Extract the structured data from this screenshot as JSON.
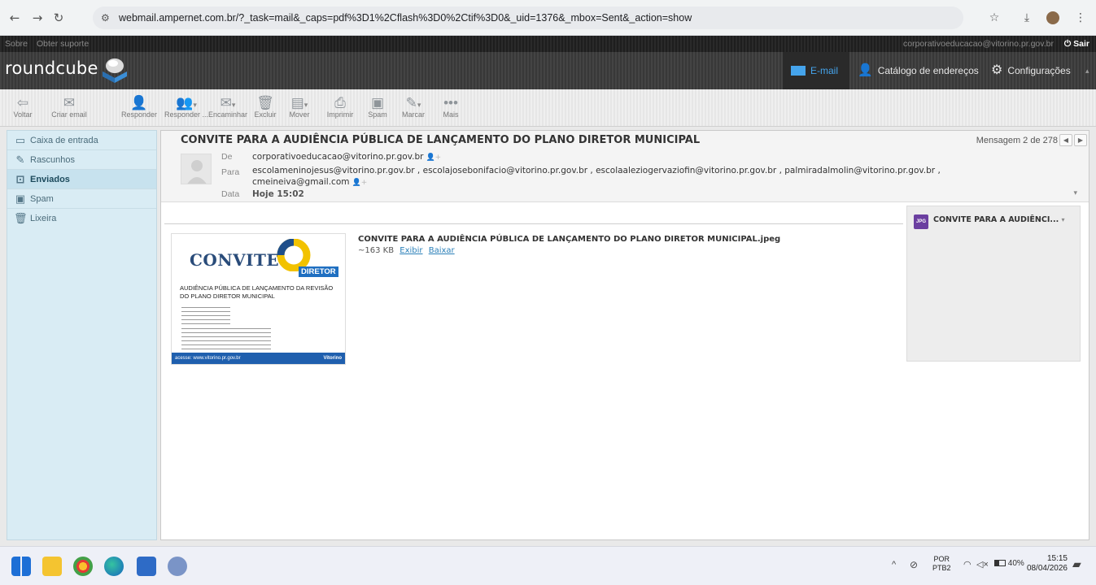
{
  "browser": {
    "url": "webmail.ampernet.com.br/?_task=mail&_caps=pdf%3D1%2Cflash%3D0%2Ctif%3D0&_uid=1376&_mbox=Sent&_action=show"
  },
  "topline": {
    "links": [
      "Sobre",
      "Obter suporte"
    ],
    "user_email": "corporativoeducacao@vitorino.pr.gov.br",
    "logout_label": "Sair"
  },
  "header": {
    "logo_text": "roundcube",
    "nav": {
      "email": "E-mail",
      "contacts": "Catálogo de endereços",
      "settings": "Configurações"
    }
  },
  "toolbar": {
    "back": "Voltar",
    "compose": "Criar email",
    "reply": "Responder",
    "reply_all": "Responder ...",
    "forward": "Encaminhar",
    "delete": "Excluir",
    "move": "Mover",
    "print": "Imprimir",
    "spam": "Spam",
    "mark": "Marcar",
    "more": "Mais"
  },
  "sidebar": {
    "folders": [
      {
        "label": "Caixa de entrada",
        "icon": "inbox-icon"
      },
      {
        "label": "Rascunhos",
        "icon": "pencil-icon"
      },
      {
        "label": "Enviados",
        "icon": "sent-icon",
        "selected": true
      },
      {
        "label": "Spam",
        "icon": "spam-icon"
      },
      {
        "label": "Lixeira",
        "icon": "trash-icon"
      }
    ]
  },
  "message": {
    "subject": "CONVITE PARA A AUDIÊNCIA PÚBLICA DE LANÇAMENTO DO PLANO DIRETOR MUNICIPAL",
    "counter": "Mensagem 2 de 278",
    "from_label": "De",
    "from": "corporativoeducacao@vitorino.pr.gov.br",
    "to_label": "Para",
    "to_line1": "escolameninojesus@vitorino.pr.gov.br , escolajosebonifacio@vitorino.pr.gov.br , escolaaleziogervaziofin@vitorino.pr.gov.br , palmiradalmolin@vitorino.pr.gov.br ,",
    "to_line2": "cmeineiva@gmail.com",
    "date_label": "Data",
    "date": "Hoje 15:02"
  },
  "attachment": {
    "filename": "CONVITE PARA A AUDIÊNCIA PÚBLICA DE LANÇAMENTO DO PLANO DIRETOR MUNICIPAL.jpeg",
    "size": "~163 KB",
    "view": "Exibir",
    "download": "Baixar",
    "panel_name": "CONVITE PARA A AUDIÊNCI...",
    "panel_type": "JPG"
  },
  "thumbnail": {
    "title": "CONVITE",
    "badge": "DIRETOR",
    "heading": "AUDIÊNCIA PÚBLICA DE LANÇAMENTO DA REVISÃO DO PLANO DIRETOR MUNICIPAL",
    "footer": "acesse: www.vitorino.pr.gov.br",
    "footer_logo": "Vitorino"
  },
  "taskbar": {
    "lang_top": "POR",
    "lang_bottom": "PTB2",
    "battery": "40%",
    "time": "15:15",
    "date": "08/04/2026"
  },
  "colors": {
    "accent_blue": "#45a4ec",
    "sidebar_bg": "#d9ecf4",
    "link": "#2a7fb8"
  }
}
